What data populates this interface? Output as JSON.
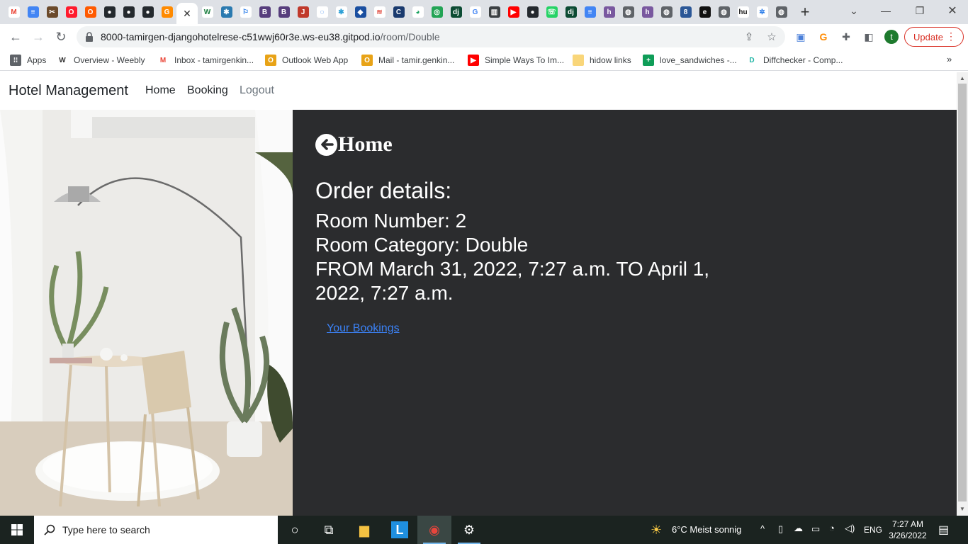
{
  "browser": {
    "tabs": [
      {
        "icon": "gmail-icon",
        "color": "#ffffff",
        "glyph": "M",
        "glyph_color": "#ea4335"
      },
      {
        "icon": "docs-icon",
        "color": "#4285f4",
        "glyph": "≡"
      },
      {
        "icon": "weebly-tools-icon",
        "color": "#6b4a2b",
        "glyph": "✂"
      },
      {
        "icon": "opera-icon",
        "color": "#ff1b2d",
        "glyph": "O"
      },
      {
        "icon": "opera-icon",
        "color": "#ff5a00",
        "glyph": "O"
      },
      {
        "icon": "github-icon",
        "color": "#24292e",
        "glyph": "●"
      },
      {
        "icon": "github-icon",
        "color": "#24292e",
        "glyph": "●"
      },
      {
        "icon": "github-icon",
        "color": "#24292e",
        "glyph": "●"
      },
      {
        "icon": "gitpod-icon",
        "color": "#ff8a00",
        "glyph": "G"
      },
      {
        "icon": "webflow-icon",
        "color": "#ffffff",
        "glyph": "W",
        "glyph_color": "#1b7e3f"
      },
      {
        "icon": "colorful-icon",
        "color": "#2a7ab0",
        "glyph": "✱"
      },
      {
        "icon": "flag-icon",
        "color": "#ffffff",
        "glyph": "⚐",
        "glyph_color": "#1a73e8"
      },
      {
        "icon": "bootstrap-icon",
        "color": "#563d7c",
        "glyph": "B"
      },
      {
        "icon": "bootstrap-icon",
        "color": "#563d7c",
        "glyph": "B"
      },
      {
        "icon": "jira-icon",
        "color": "#c0392b",
        "glyph": "J"
      },
      {
        "icon": "spiral-icon",
        "color": "#ffffff",
        "glyph": "◌",
        "glyph_color": "#1a73e8"
      },
      {
        "icon": "asterisk-icon",
        "color": "#ffffff",
        "glyph": "✱",
        "glyph_color": "#2a9fd6"
      },
      {
        "icon": "shield-icon",
        "color": "#1a4fa0",
        "glyph": "◆"
      },
      {
        "icon": "trello-icon",
        "color": "#ffffff",
        "glyph": "≋",
        "glyph_color": "#e2574c"
      },
      {
        "icon": "codeinstitute-icon",
        "color": "#1a3a6e",
        "glyph": "C"
      },
      {
        "icon": "chrome-icon",
        "color": "#ffffff",
        "glyph": "◕",
        "glyph_color": "#1aa260"
      },
      {
        "icon": "whatsapp-square-icon",
        "color": "#23a455",
        "glyph": "◎"
      },
      {
        "icon": "django-icon",
        "color": "#0c4b33",
        "glyph": "dj"
      },
      {
        "icon": "google-icon",
        "color": "#ffffff",
        "glyph": "G",
        "glyph_color": "#4285f4"
      },
      {
        "icon": "book-icon",
        "color": "#3c4043",
        "glyph": "▥"
      },
      {
        "icon": "youtube-icon",
        "color": "#ff0000",
        "glyph": "▶"
      },
      {
        "icon": "github-icon",
        "color": "#24292e",
        "glyph": "●"
      },
      {
        "icon": "whatsapp-icon",
        "color": "#25d366",
        "glyph": "☏"
      },
      {
        "icon": "django-icon",
        "color": "#0c4b33",
        "glyph": "dj"
      },
      {
        "icon": "docs-icon",
        "color": "#4285f4",
        "glyph": "≡"
      },
      {
        "icon": "heroku-icon",
        "color": "#79589f",
        "glyph": "h"
      },
      {
        "icon": "globe-icon",
        "color": "#5f6368",
        "glyph": "◍"
      },
      {
        "icon": "heroku-icon",
        "color": "#79589f",
        "glyph": "h"
      },
      {
        "icon": "globe-icon",
        "color": "#5f6368",
        "glyph": "◍"
      },
      {
        "icon": "grid-icon",
        "color": "#2b5797",
        "glyph": "8"
      },
      {
        "icon": "editor-icon",
        "color": "#111111",
        "glyph": "e"
      },
      {
        "icon": "globe-icon",
        "color": "#5f6368",
        "glyph": "◍"
      },
      {
        "icon": "hu-icon",
        "color": "#ffffff",
        "glyph": "hu",
        "glyph_color": "#1a1a1a"
      },
      {
        "icon": "gear-icon",
        "color": "#ffffff",
        "glyph": "✲",
        "glyph_color": "#1a73e8"
      },
      {
        "icon": "globe-icon",
        "color": "#5f6368",
        "glyph": "◍"
      }
    ],
    "active_tab_after": 9,
    "url_host": "8000-tamirgen-djangohotelrese-c51wwj60r3e.ws-eu38.gitpod.io",
    "url_path": "/room/Double",
    "avatar_letter": "t",
    "update_label": "Update",
    "bookmarks": [
      {
        "label": "Apps",
        "icon": "apps-grid-icon",
        "color": "#5f6368",
        "glyph": "⁝⁝"
      },
      {
        "label": "Overview - Weebly",
        "icon": "weebly-icon",
        "color": "#ffffff",
        "glyph": "W",
        "glyph_color": "#333333"
      },
      {
        "label": "Inbox - tamirgenkin...",
        "icon": "gmail-icon",
        "color": "#ffffff",
        "glyph": "M",
        "glyph_color": "#ea4335"
      },
      {
        "label": "Outlook Web App",
        "icon": "outlook-icon",
        "color": "#e8a317",
        "glyph": "O"
      },
      {
        "label": "Mail - tamir.genkin...",
        "icon": "outlook-icon",
        "color": "#e8a317",
        "glyph": "O"
      },
      {
        "label": "Simple Ways To Im...",
        "icon": "youtube-icon",
        "color": "#ff0000",
        "glyph": "▶"
      },
      {
        "label": "hidow links",
        "icon": "folder-icon",
        "color": "#f9d67a",
        "glyph": ""
      },
      {
        "label": "love_sandwiches -...",
        "icon": "sheets-icon",
        "color": "#0f9d58",
        "glyph": "+"
      },
      {
        "label": "Diffchecker - Comp...",
        "icon": "diffchecker-icon",
        "color": "#ffffff",
        "glyph": "D",
        "glyph_color": "#1fb5a5"
      }
    ]
  },
  "site": {
    "brand": "Hotel Management",
    "nav": [
      {
        "label": "Home",
        "color": "#212529"
      },
      {
        "label": "Booking",
        "color": "#212529"
      },
      {
        "label": "Logout",
        "color": "#6c757d"
      }
    ],
    "back_label": "Home",
    "order_title": "Order details:",
    "room_number": "Room Number: 2",
    "room_category": "Room Category: Double",
    "date_range": "FROM March 31, 2022, 7:27 a.m. TO April 1, 2022, 7:27 a.m.",
    "bookings_link": "Your Bookings",
    "content_bg": "#2b2c2e",
    "link_color": "#3b82f6"
  },
  "taskbar": {
    "search_placeholder": "Type here to search",
    "weather": "6°C  Meist sonnig",
    "language": "ENG",
    "time": "7:27 AM",
    "date": "3/26/2022",
    "apps": [
      {
        "name": "cortana-icon",
        "glyph": "○"
      },
      {
        "name": "task-view-icon",
        "glyph": "⧉"
      },
      {
        "name": "file-explorer-icon",
        "glyph": "▆"
      },
      {
        "name": "l-app-icon",
        "glyph": "L"
      },
      {
        "name": "chrome-icon",
        "glyph": "◉"
      },
      {
        "name": "settings-icon",
        "glyph": "⚙"
      }
    ]
  }
}
